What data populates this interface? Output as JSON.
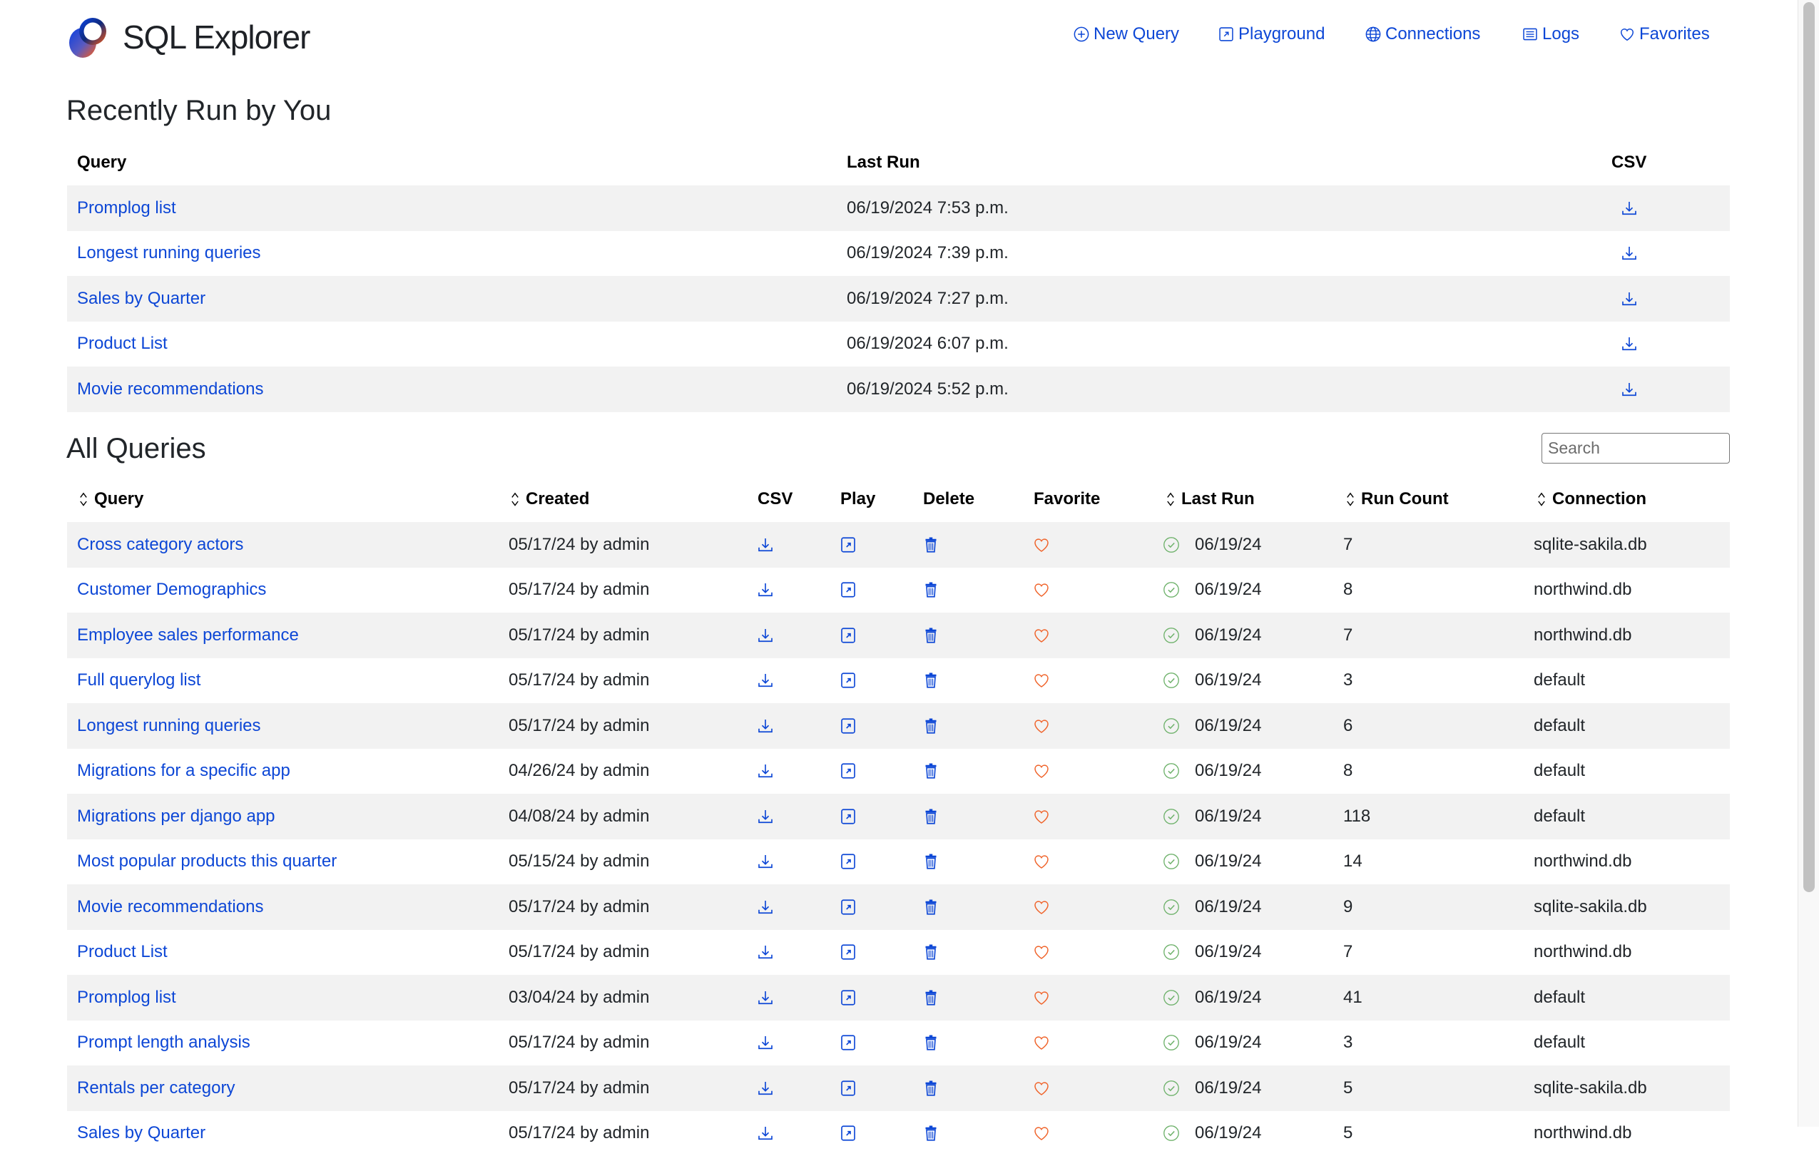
{
  "app": {
    "title": "SQL Explorer"
  },
  "nav": [
    {
      "label": "New Query",
      "icon": "plus-circle-icon"
    },
    {
      "label": "Playground",
      "icon": "box-arrow-up-right-icon"
    },
    {
      "label": "Connections",
      "icon": "globe-icon"
    },
    {
      "label": "Logs",
      "icon": "list-icon"
    },
    {
      "label": "Favorites",
      "icon": "heart-icon"
    }
  ],
  "recent": {
    "title": "Recently Run by You",
    "headers": {
      "query": "Query",
      "last_run": "Last Run",
      "csv": "CSV"
    },
    "rows": [
      {
        "query": "Promplog list",
        "last_run": "06/19/2024 7:53 p.m."
      },
      {
        "query": "Longest running queries",
        "last_run": "06/19/2024 7:39 p.m."
      },
      {
        "query": "Sales by Quarter",
        "last_run": "06/19/2024 7:27 p.m."
      },
      {
        "query": "Product List",
        "last_run": "06/19/2024 6:07 p.m."
      },
      {
        "query": "Movie recommendations",
        "last_run": "06/19/2024 5:52 p.m."
      }
    ]
  },
  "all": {
    "title": "All Queries",
    "search_placeholder": "Search",
    "search_value": "",
    "headers": {
      "query": "Query",
      "created": "Created",
      "csv": "CSV",
      "play": "Play",
      "delete": "Delete",
      "favorite": "Favorite",
      "last_run": "Last Run",
      "run_count": "Run Count",
      "connection": "Connection"
    },
    "rows": [
      {
        "query": "Cross category actors",
        "created": "05/17/24 by admin",
        "last_run": "06/19/24",
        "run_count": "7",
        "connection": "sqlite-sakila.db"
      },
      {
        "query": "Customer Demographics",
        "created": "05/17/24 by admin",
        "last_run": "06/19/24",
        "run_count": "8",
        "connection": "northwind.db"
      },
      {
        "query": "Employee sales performance",
        "created": "05/17/24 by admin",
        "last_run": "06/19/24",
        "run_count": "7",
        "connection": "northwind.db"
      },
      {
        "query": "Full querylog list",
        "created": "05/17/24 by admin",
        "last_run": "06/19/24",
        "run_count": "3",
        "connection": "default"
      },
      {
        "query": "Longest running queries",
        "created": "05/17/24 by admin",
        "last_run": "06/19/24",
        "run_count": "6",
        "connection": "default"
      },
      {
        "query": "Migrations for a specific app",
        "created": "04/26/24 by admin",
        "last_run": "06/19/24",
        "run_count": "8",
        "connection": "default"
      },
      {
        "query": "Migrations per django app",
        "created": "04/08/24 by admin",
        "last_run": "06/19/24",
        "run_count": "118",
        "connection": "default"
      },
      {
        "query": "Most popular products this quarter",
        "created": "05/15/24 by admin",
        "last_run": "06/19/24",
        "run_count": "14",
        "connection": "northwind.db"
      },
      {
        "query": "Movie recommendations",
        "created": "05/17/24 by admin",
        "last_run": "06/19/24",
        "run_count": "9",
        "connection": "sqlite-sakila.db"
      },
      {
        "query": "Product List",
        "created": "05/17/24 by admin",
        "last_run": "06/19/24",
        "run_count": "7",
        "connection": "northwind.db"
      },
      {
        "query": "Promplog list",
        "created": "03/04/24 by admin",
        "last_run": "06/19/24",
        "run_count": "41",
        "connection": "default"
      },
      {
        "query": "Prompt length analysis",
        "created": "05/17/24 by admin",
        "last_run": "06/19/24",
        "run_count": "3",
        "connection": "default"
      },
      {
        "query": "Rentals per category",
        "created": "05/17/24 by admin",
        "last_run": "06/19/24",
        "run_count": "5",
        "connection": "sqlite-sakila.db"
      },
      {
        "query": "Sales by Quarter",
        "created": "05/17/24 by admin",
        "last_run": "06/19/24",
        "run_count": "5",
        "connection": "northwind.db"
      }
    ]
  },
  "colors": {
    "link": "#0d47d6",
    "favorite": "#f0632a",
    "success": "#6fb26c",
    "stripe": "#f2f2f2"
  }
}
